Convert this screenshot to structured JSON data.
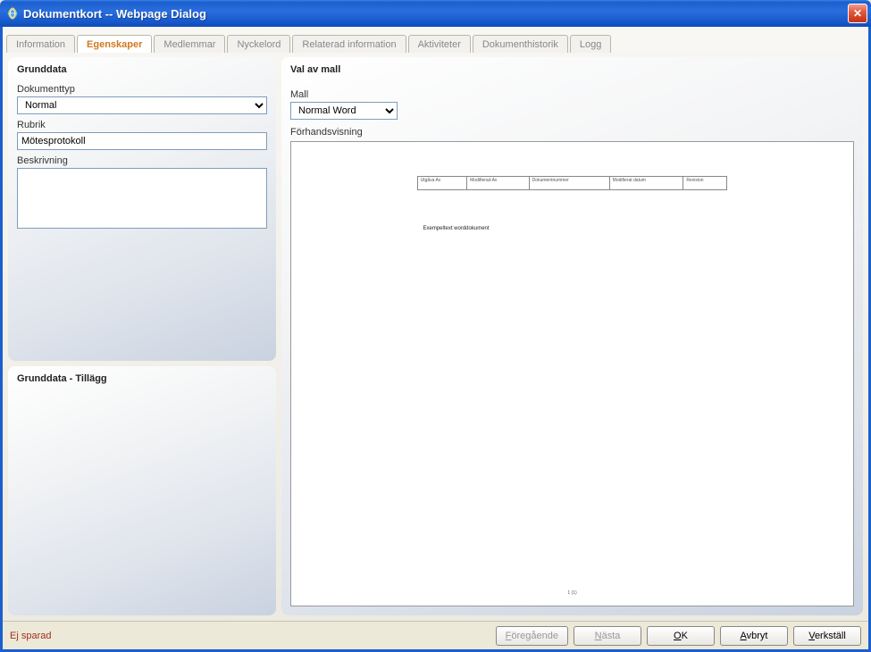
{
  "window": {
    "title": "Dokumentkort -- Webpage Dialog"
  },
  "tabs": {
    "items": [
      {
        "label": "Information",
        "active": false
      },
      {
        "label": "Egenskaper",
        "active": true
      },
      {
        "label": "Medlemmar",
        "active": false
      },
      {
        "label": "Nyckelord",
        "active": false
      },
      {
        "label": "Relaterad information",
        "active": false
      },
      {
        "label": "Aktiviteter",
        "active": false
      },
      {
        "label": "Dokumenthistorik",
        "active": false
      },
      {
        "label": "Logg",
        "active": false
      }
    ]
  },
  "left": {
    "grunddata_title": "Grunddata",
    "dokumenttyp_label": "Dokumenttyp",
    "dokumenttyp_value": "Normal",
    "rubrik_label": "Rubrik",
    "rubrik_value": "Mötesprotokoll",
    "beskrivning_label": "Beskrivning",
    "beskrivning_value": "",
    "tillagg_title": "Grunddata - Tillägg"
  },
  "right": {
    "title": "Val av mall",
    "mall_label": "Mall",
    "mall_value": "Normal Word",
    "preview_label": "Förhandsvisning",
    "preview": {
      "headers": [
        "Utgåva Av",
        "Modifierad Av",
        "Dokumentnummer",
        "Modifierat datum",
        "Revision"
      ],
      "body_text": "Exempeltext worddokument",
      "footer": "1 (1)"
    }
  },
  "footer": {
    "status": "Ej sparad",
    "btn_prev": "Föregående",
    "btn_next": "Nästa",
    "btn_ok": "OK",
    "btn_cancel": "Avbryt",
    "btn_apply": "Verkställ"
  }
}
